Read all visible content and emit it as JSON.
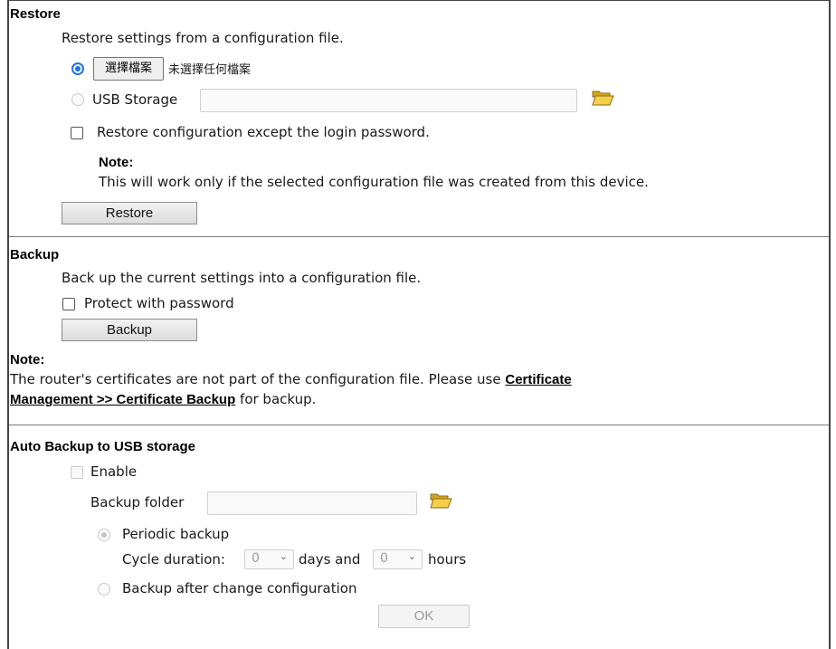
{
  "restore": {
    "title": "Restore",
    "description": "Restore settings from a configuration file.",
    "choose_file_label": "選擇檔案",
    "no_file_text": "未選擇任何檔案",
    "usb_storage_label": "USB Storage",
    "usb_storage_value": "",
    "except_password_label": "Restore configuration except the login password.",
    "note_title": "Note:",
    "note_text": "This will work only if the selected configuration file was created from this device.",
    "button_label": "Restore"
  },
  "backup": {
    "title": "Backup",
    "description": "Back up the current settings into a configuration file.",
    "protect_label": "Protect with password",
    "button_label": "Backup",
    "note_title": "Note:",
    "note_text_before": "The router's certificates are not part of the configuration file. Please use ",
    "note_link_part1": "Certificate",
    "note_link_part2": "Management >> Certificate Backup",
    "note_text_after": " for backup."
  },
  "auto_backup": {
    "title": "Auto Backup to USB storage",
    "enable_label": "Enable",
    "folder_label": "Backup folder",
    "folder_value": "",
    "periodic_label": "Periodic backup",
    "cycle_label": "Cycle duration:",
    "days_value": "0",
    "days_label": "days and",
    "hours_value": "0",
    "hours_label": "hours",
    "after_change_label": "Backup after change configuration",
    "ok_label": "OK"
  },
  "icons": {
    "folder": "folder-open-icon",
    "chevron": "chevron-down-icon"
  },
  "colors": {
    "radio_accent": "#1a73e8",
    "separator": "#7a7a7a"
  }
}
